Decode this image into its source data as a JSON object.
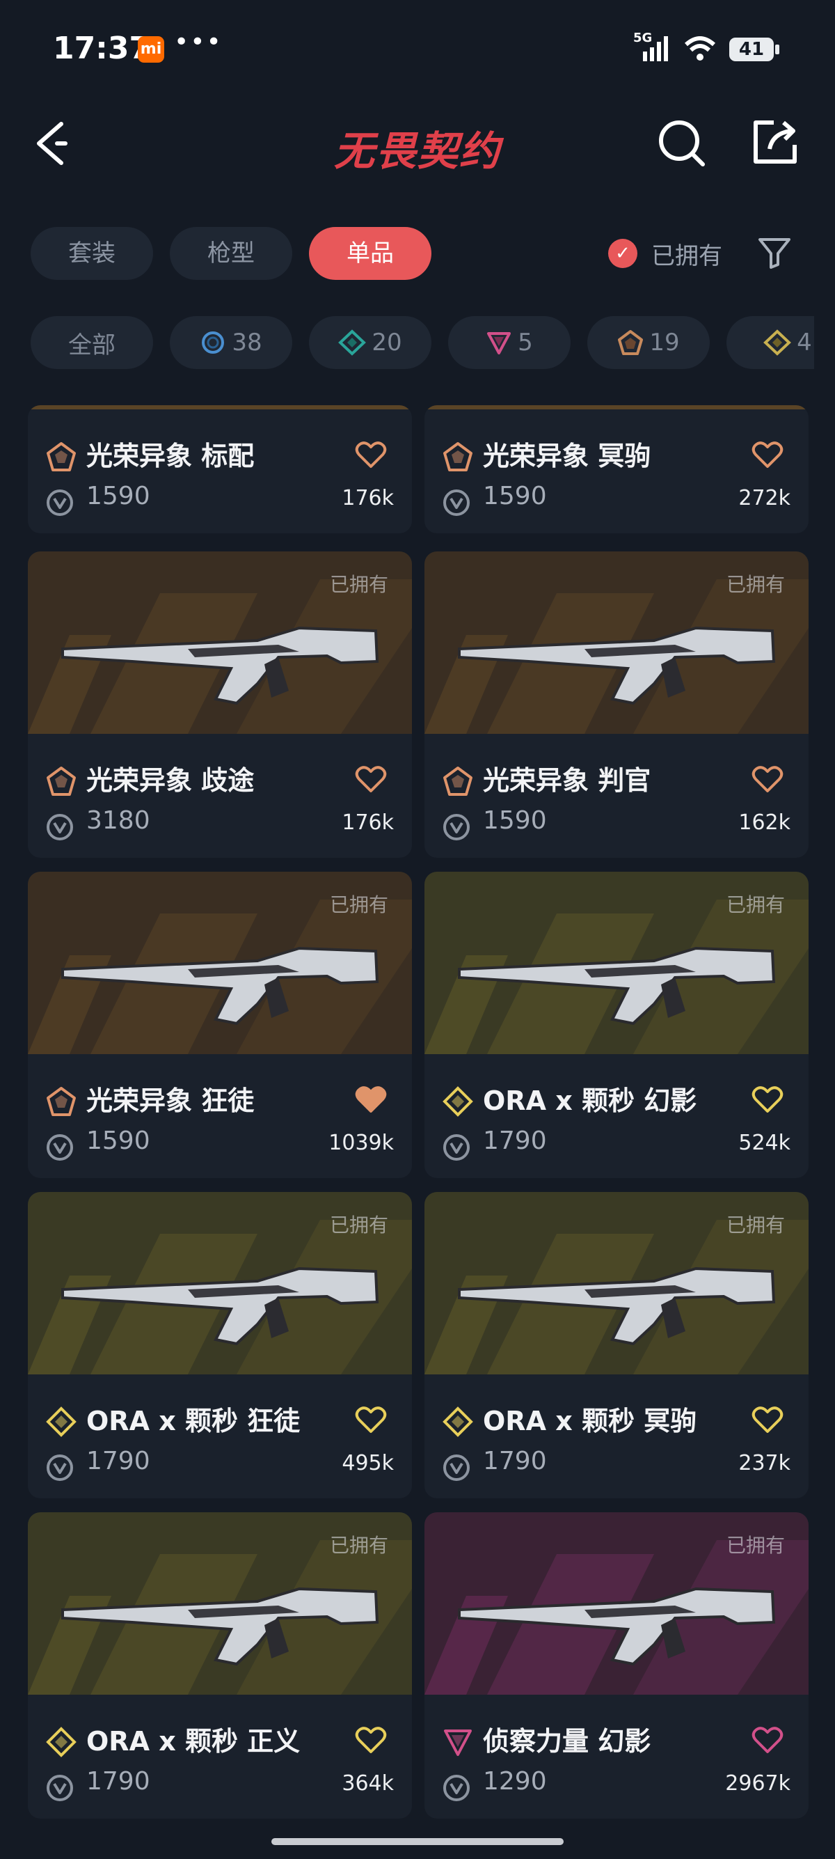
{
  "status_bar": {
    "time": "17:37",
    "app_badge": "mi",
    "network": "5G",
    "battery": "41"
  },
  "header": {
    "title": "无畏契约",
    "back_icon": "back-arrow-icon",
    "search_icon": "search-icon",
    "share_icon": "share-icon"
  },
  "tabs": [
    {
      "label": "套装",
      "active": false
    },
    {
      "label": "枪型",
      "active": false
    },
    {
      "label": "单品",
      "active": true
    }
  ],
  "owned_filter": {
    "label": "已拥有",
    "checked": true
  },
  "tier_chips": [
    {
      "label": "全部",
      "icon": null
    },
    {
      "label": "38",
      "icon": "tier-select-icon"
    },
    {
      "label": "20",
      "icon": "tier-deluxe-icon"
    },
    {
      "label": "5",
      "icon": "tier-premium-icon"
    },
    {
      "label": "19",
      "icon": "tier-exclusive-icon"
    },
    {
      "label": "4",
      "icon": "tier-ultra-icon"
    }
  ],
  "items": [
    {
      "name": "光荣异象 标配",
      "price": "1590",
      "likes": "176k",
      "tier": "exclusive",
      "owned": "",
      "liked": false,
      "partial": true
    },
    {
      "name": "光荣异象 冥驹",
      "price": "1590",
      "likes": "272k",
      "tier": "exclusive",
      "owned": "",
      "liked": false,
      "partial": true
    },
    {
      "name": "光荣异象 歧途",
      "price": "3180",
      "likes": "176k",
      "tier": "exclusive",
      "owned": "已拥有",
      "liked": false
    },
    {
      "name": "光荣异象 判官",
      "price": "1590",
      "likes": "162k",
      "tier": "exclusive",
      "owned": "已拥有",
      "liked": false
    },
    {
      "name": "光荣异象 狂徒",
      "price": "1590",
      "likes": "1039k",
      "tier": "exclusive",
      "owned": "已拥有",
      "liked": true
    },
    {
      "name": "ORA x 颗秒 幻影",
      "price": "1790",
      "likes": "524k",
      "tier": "ultra",
      "owned": "已拥有",
      "liked": false
    },
    {
      "name": "ORA x 颗秒 狂徒",
      "price": "1790",
      "likes": "495k",
      "tier": "ultra",
      "owned": "已拥有",
      "liked": false
    },
    {
      "name": "ORA x 颗秒 冥驹",
      "price": "1790",
      "likes": "237k",
      "tier": "ultra",
      "owned": "已拥有",
      "liked": false
    },
    {
      "name": "ORA x 颗秒 正义",
      "price": "1790",
      "likes": "364k",
      "tier": "ultra",
      "owned": "已拥有",
      "liked": false
    },
    {
      "name": "侦察力量 幻影",
      "price": "1290",
      "likes": "2967k",
      "tier": "premium",
      "owned": "已拥有",
      "liked": false
    }
  ],
  "colors": {
    "accent": "#e8585a",
    "exclusive": "#e0946a",
    "ultra": "#e8cf5a",
    "premium": "#d2508a",
    "deluxe": "#2aa59a",
    "select": "#4a8fd0"
  }
}
